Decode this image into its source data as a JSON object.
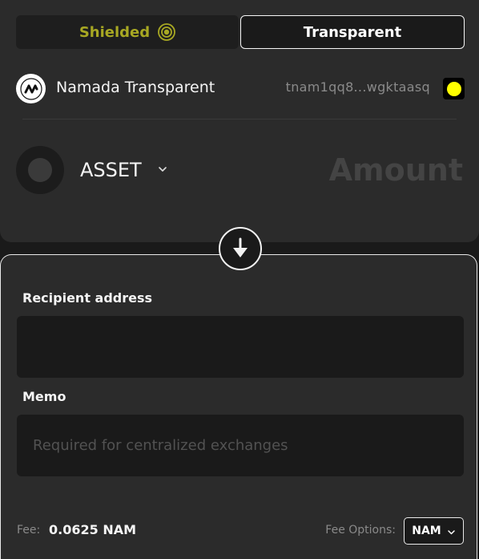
{
  "tabs": {
    "shielded_label": "Shielded",
    "transparent_label": "Transparent",
    "active": "Transparent"
  },
  "source_account": {
    "name": "Namada Transparent",
    "address": "tnam1qq8...wgktaasq",
    "logo_icon": "namada-logo-icon",
    "wallet_icon": "wallet-dot-icon"
  },
  "asset": {
    "label": "ASSET",
    "amount_placeholder": "Amount"
  },
  "recipient": {
    "label": "Recipient address",
    "value": "",
    "placeholder": ""
  },
  "memo": {
    "label": "Memo",
    "placeholder": "Required for centralized exchanges"
  },
  "fee": {
    "label": "Fee:",
    "value": "0.0625 NAM",
    "options_label": "Fee Options:",
    "selected_option": "NAM"
  },
  "colors": {
    "shielded_accent": "#a8a823",
    "wallet_yellow": "#ffff00",
    "panel_bg": "#2b2b2b",
    "input_bg": "#1a1a1a"
  }
}
